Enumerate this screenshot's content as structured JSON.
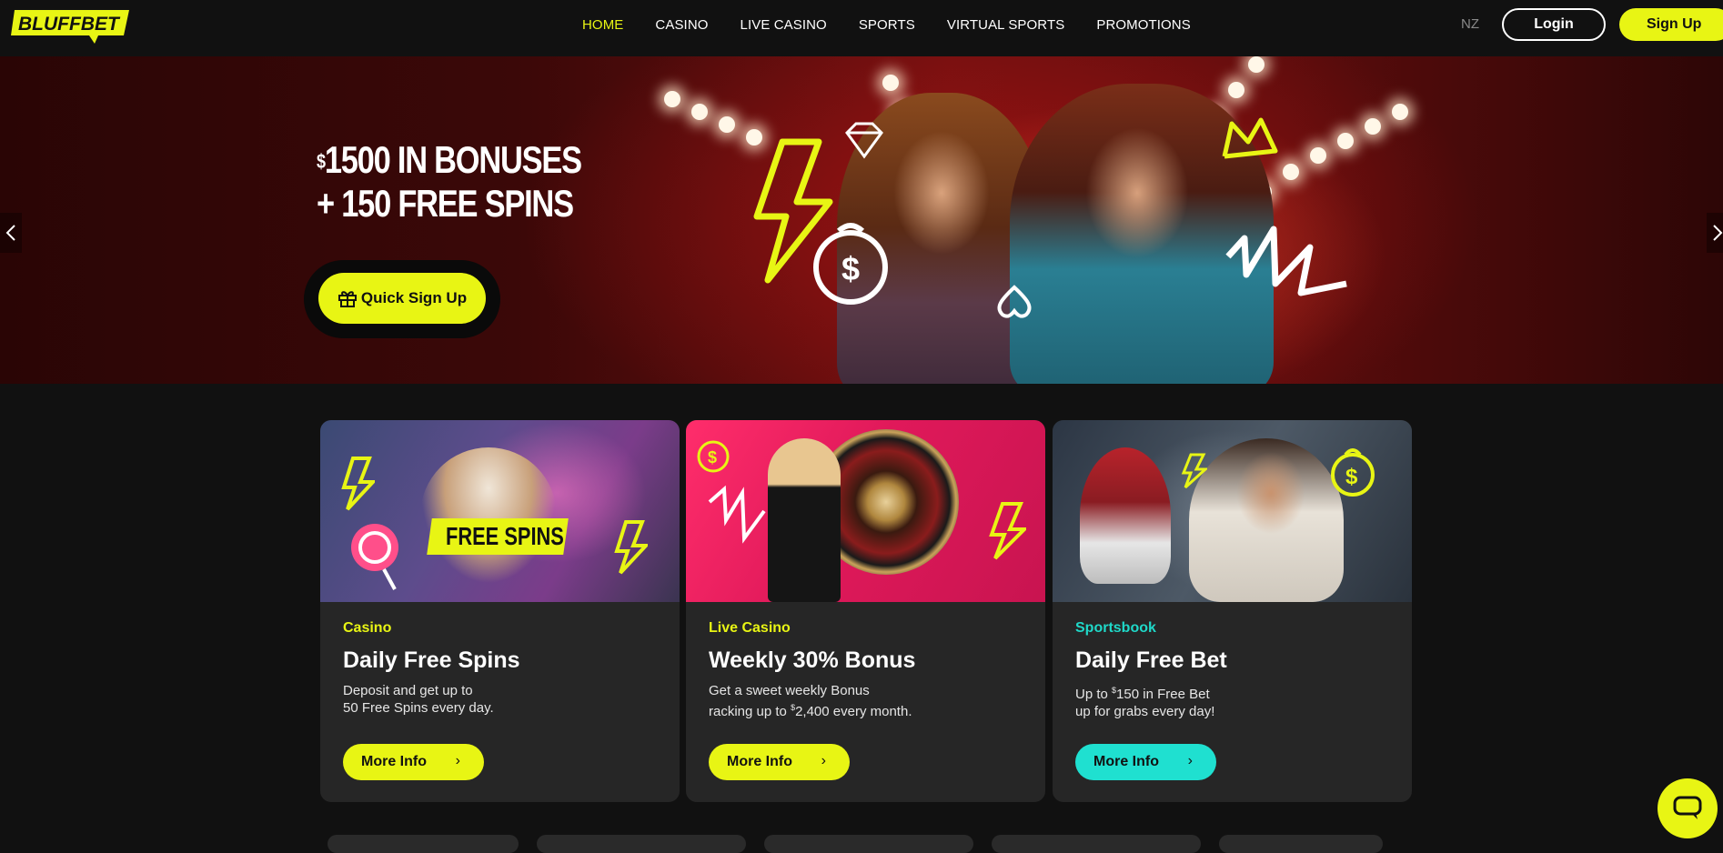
{
  "header": {
    "logo_text": "BLUFFBET",
    "nav": [
      "HOME",
      "CASINO",
      "LIVE CASINO",
      "SPORTS",
      "VIRTUAL SPORTS",
      "PROMOTIONS"
    ],
    "active_nav": "HOME",
    "region": "NZ",
    "login_label": "Login",
    "signup_label": "Sign Up"
  },
  "hero": {
    "currency_symbol": "$",
    "line1": "1500 IN BONUSES",
    "line2": "+ 150 FREE SPINS",
    "cta_label": "Quick Sign Up"
  },
  "cards": [
    {
      "category": "Casino",
      "category_color": "#e8f514",
      "title": "Daily Free Spins",
      "desc_line1": "Deposit and get up to",
      "desc_line2": "50 Free Spins every day.",
      "button_label": "More Info",
      "button_color": "#e8f514",
      "image_badge": "FREE SPINS"
    },
    {
      "category": "Live Casino",
      "category_color": "#e8f514",
      "title": "Weekly 30% Bonus",
      "desc_line1": "Get a sweet weekly Bonus",
      "desc_line2_pre": "racking up to ",
      "desc_line2_sup": "$",
      "desc_line2_post": "2,400 every month.",
      "button_label": "More Info",
      "button_color": "#e8f514"
    },
    {
      "category": "Sportsbook",
      "category_color": "#1fd8c8",
      "title": "Daily Free Bet",
      "desc_line1_pre": "Up to ",
      "desc_line1_sup": "$",
      "desc_line1_post": "150 in Free Bet",
      "desc_line2": "up for grabs every day!",
      "button_label": "More Info",
      "button_color": "#1fe0d0"
    }
  ],
  "colors": {
    "accent": "#e8f514",
    "teal": "#1fd8c8",
    "background": "#111111",
    "card": "#262626"
  },
  "icons": [
    "chevron-left-icon",
    "chevron-right-icon",
    "gift-icon",
    "chat-icon"
  ]
}
